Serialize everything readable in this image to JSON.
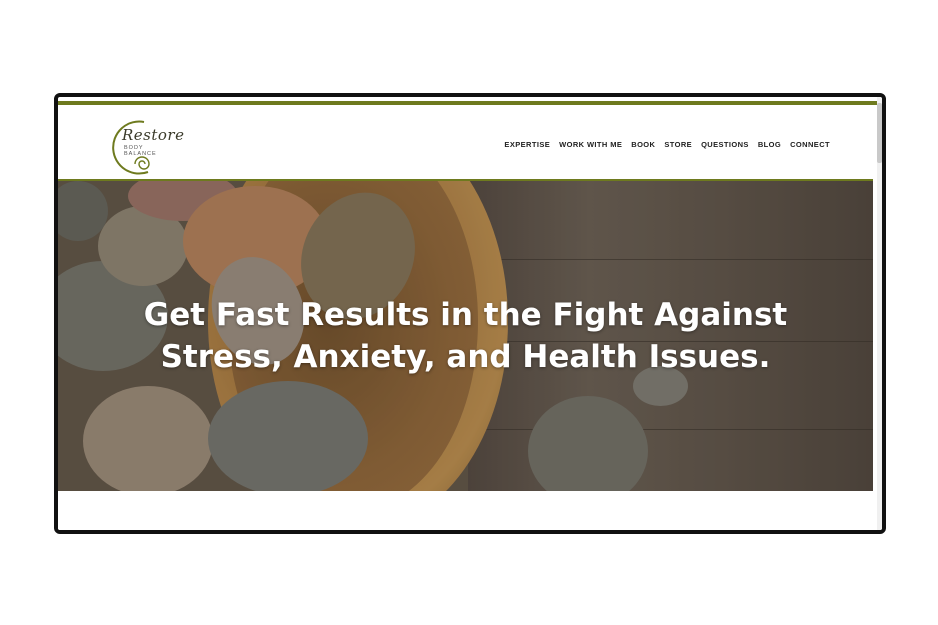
{
  "logo": {
    "name": "Restore",
    "tagline": "BODY BALANCE"
  },
  "nav": {
    "items": [
      {
        "label": "EXPERTISE"
      },
      {
        "label": "WORK WITH ME"
      },
      {
        "label": "BOOK"
      },
      {
        "label": "STORE"
      },
      {
        "label": "QUESTIONS"
      },
      {
        "label": "BLOG"
      },
      {
        "label": "CONNECT"
      }
    ]
  },
  "hero": {
    "headline_line1": "Get Fast Results in the Fight Against",
    "headline_line2": "Stress, Anxiety, and Health Issues."
  },
  "colors": {
    "accent": "#6e7a1e",
    "frame": "#111111",
    "nav_text": "#222222",
    "headline": "#ffffff"
  },
  "icons": {
    "logo_mark": "spiral-icon"
  }
}
